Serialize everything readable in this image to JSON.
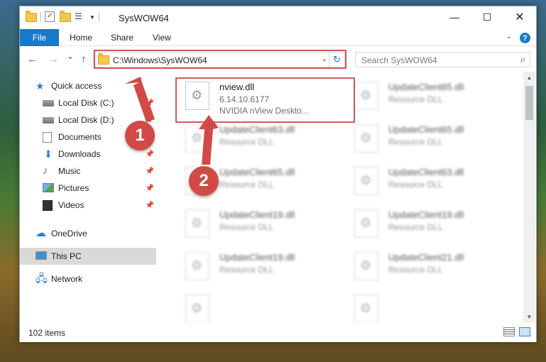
{
  "window": {
    "title": "SysWOW64",
    "min_glyph": "—",
    "max_glyph": "☐",
    "close_glyph": "✕"
  },
  "ribbon": {
    "file": "File",
    "tabs": [
      "Home",
      "Share",
      "View"
    ]
  },
  "nav": {
    "back": "←",
    "forward": "→",
    "recent": "⌄",
    "up": "↑",
    "address": "C:\\Windows\\SysWOW64",
    "search_placeholder": "Search SysWOW64"
  },
  "sidebar": {
    "items": [
      {
        "label": "Quick access",
        "icon": "star-icon",
        "pinned": false
      },
      {
        "label": "Local Disk (C:)",
        "icon": "drive-icon",
        "pinned": true
      },
      {
        "label": "Local Disk (D:)",
        "icon": "drive-icon",
        "pinned": true
      },
      {
        "label": "Documents",
        "icon": "documents-icon",
        "pinned": true
      },
      {
        "label": "Downloads",
        "icon": "downloads-icon",
        "pinned": true
      },
      {
        "label": "Music",
        "icon": "music-icon",
        "pinned": true
      },
      {
        "label": "Pictures",
        "icon": "pictures-icon",
        "pinned": true
      },
      {
        "label": "Videos",
        "icon": "videos-icon",
        "pinned": true
      },
      {
        "label": "OneDrive",
        "icon": "onedrive-icon",
        "pinned": false
      },
      {
        "label": "This PC",
        "icon": "pc-icon",
        "pinned": false,
        "selected": true
      },
      {
        "label": "Network",
        "icon": "network-icon",
        "pinned": false
      }
    ]
  },
  "files": [
    {
      "name": "nview.dll",
      "line1": "6.14.10.6177",
      "line2": "NVIDIA nView Deskto...",
      "blurred": false
    },
    {
      "name": "UpdateClient65.dll",
      "line1": "Resource DLL",
      "blurred": true
    },
    {
      "name": "UpdateClient63.dll",
      "line1": "Resource DLL",
      "blurred": true
    },
    {
      "name": "UpdateClient65.dll",
      "line1": "Resource DLL",
      "blurred": true
    },
    {
      "name": "UpdateClient65.dll",
      "line1": "Resource DLL",
      "blurred": true
    },
    {
      "name": "UpdateClient63.dll",
      "line1": "Resource DLL",
      "blurred": true
    },
    {
      "name": "UpdateClient19.dll",
      "line1": "Resource DLL",
      "blurred": true
    },
    {
      "name": "UpdateClient19.dll",
      "line1": "Resource DLL",
      "blurred": true
    },
    {
      "name": "UpdateClient19.dll",
      "line1": "Resource DLL",
      "blurred": true
    },
    {
      "name": "UpdateClient21.dll",
      "line1": "Resource DLL",
      "blurred": true
    }
  ],
  "status": {
    "items": "102 items"
  },
  "annotations": {
    "badge1": "1",
    "badge2": "2",
    "color": "#d24a45"
  },
  "colors": {
    "accent": "#1979ca",
    "highlight": "#d6585a"
  }
}
